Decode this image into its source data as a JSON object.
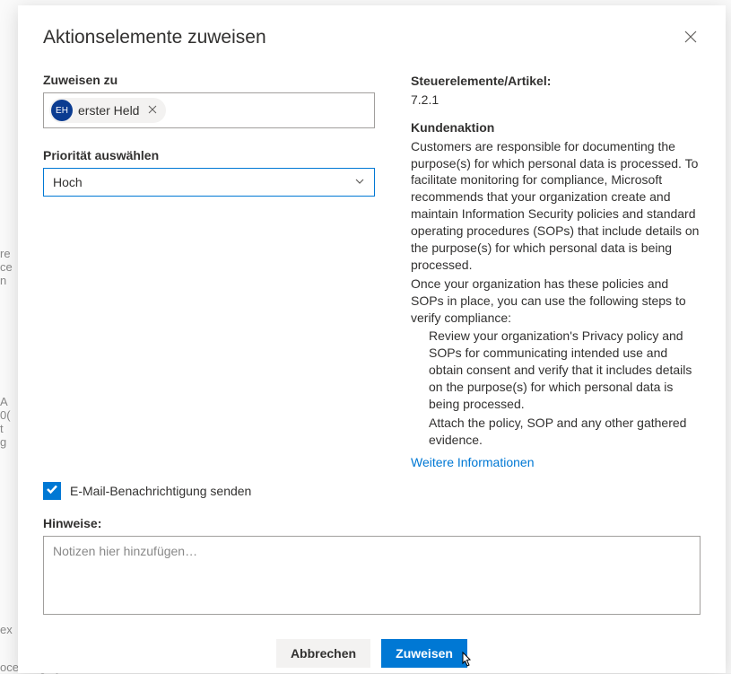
{
  "dialog": {
    "title": "Aktionselemente zuweisen",
    "close_aria": "Schließen"
  },
  "assign": {
    "label": "Zuweisen zu",
    "chip": {
      "initials": "EH",
      "name": "erster Held"
    }
  },
  "priority": {
    "label": "Priorität auswählen",
    "value": "Hoch"
  },
  "email_checkbox": {
    "label": "E-Mail-Benachrichtigung senden",
    "checked": true
  },
  "notes": {
    "label": "Hinweise:",
    "placeholder": "Notizen hier hinzufügen…"
  },
  "buttons": {
    "cancel": "Abbrechen",
    "assign": "Zuweisen"
  },
  "info": {
    "controls_label": "Steuerelemente/Artikel:",
    "controls_value": "7.2.1",
    "customer_action_label": "Kundenaktion",
    "para1": "Customers are responsible for documenting the purpose(s) for which personal data is processed. To facilitate monitoring for compliance, Microsoft recommends that your organization create and maintain Information Security policies and standard operating procedures (SOPs) that include details on the purpose(s) for which personal data is being processed.",
    "para2": "Once your organization has these policies and SOPs in place, you can use the following steps to verify compliance:",
    "step1": "Review your organization's Privacy policy and SOPs for communicating intended use and obtain consent and verify that it includes details on the purpose(s) for which personal data is being processed.",
    "step2": "Attach the policy, SOP and any other gathered evidence.",
    "more_link": "Weitere Informationen"
  },
  "background_fragments": {
    "a": "re\nce\nn",
    "b": "A\n0(\nt\ng",
    "c": "ex",
    "d": "ocessing by Union or Member"
  }
}
